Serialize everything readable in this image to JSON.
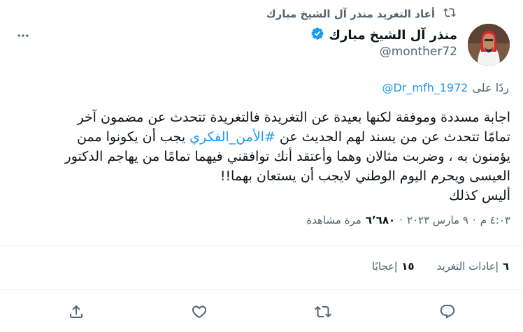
{
  "retweet": {
    "text": "أعاد التغريد منذر آل الشيخ مبارك",
    "icon": "retweet-icon"
  },
  "author": {
    "name": "منذر آل الشيخ مبارك",
    "handle": "@monther72",
    "verified": true,
    "avatar_icon": "avatar-photo"
  },
  "reply": {
    "prefix": "ردًا على",
    "to": "@Dr_mfh_1972"
  },
  "tweet": {
    "line1": "اجابة مسددة وموفقة لكنها بعيدة عن التغريدة فالتغريدة تتحدث عن مضمون آخر",
    "line2_a": "تمامًا تتحدث عن من يسند لهم الحديث عن ",
    "hashtag": "#الأمن_الفكري",
    "line2_b": " يجب أن يكونوا ممن",
    "line3": "يؤمنون به ، وضربت مثالان وهما وأعتقد أنك توافقني فيهما تمامًا من يهاجم الدكتور",
    "line4": "العيسى ويحرم اليوم الوطني لايجب أن يستعان بهما!!",
    "line5": "أليس كذلك"
  },
  "meta": {
    "time": "٤:٠٣ م",
    "date": "٩ مارس ٢٠٢٣",
    "separator": "·",
    "views_count": "٦٬٦٨٠",
    "views_label": "مرة مشاهدة"
  },
  "stats": {
    "retweets_count": "٦",
    "retweets_label": "إعادات التغريد",
    "likes_count": "١٥",
    "likes_label": "إعجابًا"
  },
  "colors": {
    "accent": "#1d9bf0",
    "muted": "#536471",
    "text": "#0f1419",
    "divider": "#eff3f4"
  }
}
